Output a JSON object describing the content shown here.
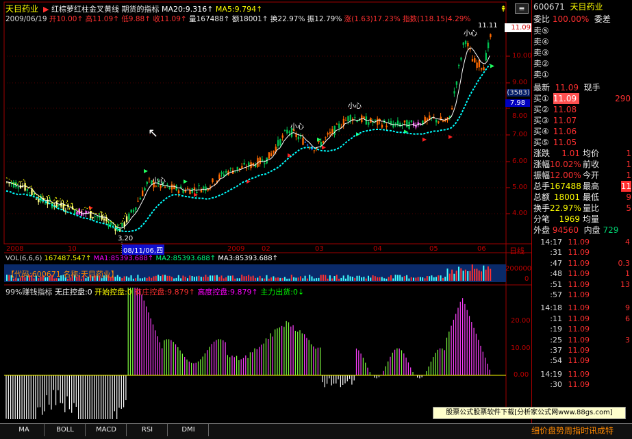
{
  "colors": {
    "up": "#ff3030",
    "up_bar": "#ff6a00",
    "down": "#00d070",
    "axis": "#c00000",
    "yellow": "#ffff00",
    "white": "#ffffff",
    "cyan": "#00ffff",
    "magenta": "#ff00ff",
    "blue_panel": "#0a2a6a"
  },
  "header": {
    "stock_name": "天目药业",
    "indicator_name": "红棕萝红柱金叉黄线 期货的指标",
    "ma20": "MA20:9.316",
    "ma5": "MA5:9.794",
    "date": "2009/06/19",
    "open": "开10.00",
    "high": "高11.09",
    "low": "低9.88",
    "close": "收11.09",
    "volume": "量167488",
    "amount": "额18001",
    "turnover": "换22.97%",
    "amplitude": "振12.79%",
    "change": "涨(1.63)17.23%",
    "index": "指数(118.15)4.29%"
  },
  "price_axis": {
    "labels": [
      "11.09",
      "10.00",
      "9.00",
      "8.00",
      "7.00",
      "6.00",
      "5.00",
      "4.00"
    ],
    "badge_3583": "(3583)",
    "badge_798": "7.98"
  },
  "price_annotations": {
    "low_mark": "3.20",
    "high_mark": "11.11",
    "xin1": "小心",
    "xin2": "小心",
    "xin3": "小心",
    "xin4": "小心"
  },
  "date_axis": {
    "labels": [
      "2008",
      "10",
      "2009",
      "02",
      "03",
      "04",
      "05",
      "06"
    ],
    "cursor_date": "08/11/06,四",
    "right_label": "日线"
  },
  "volume_panel": {
    "title": "VOL(6,6,6)",
    "vol": "167487.547",
    "ma1": "MA1:85393.688",
    "ma2": "MA2:85393.688",
    "ma3": "MA3:85393.688",
    "code_label": "【代码:600671 名称:天目药业】",
    "axis_top": "200000",
    "axis_bottom": "0"
  },
  "indicator_panel": {
    "title": "99%赚钱指标",
    "item1": "无庄控盘:0",
    "item2": "开始控盘:0",
    "item3": "有庄控盘:9.879",
    "item4": "高度控盘:9.879",
    "item5": "主力出货:0",
    "axis": [
      "20.00",
      "10.00",
      "0.00"
    ]
  },
  "quote": {
    "code": "600671",
    "name": "天目药业",
    "weibi_label": "委比",
    "weibi_value": "100.00%",
    "weicha_label": "委差",
    "sell": [
      "卖⑤",
      "卖④",
      "卖③",
      "卖②",
      "卖①"
    ],
    "latest_label": "最新",
    "latest_value": "11.09",
    "xianshou_label": "现手",
    "buy": [
      {
        "label": "买①",
        "price": "11.09",
        "vol": "290"
      },
      {
        "label": "买②",
        "price": "11.08",
        "vol": ""
      },
      {
        "label": "买③",
        "price": "11.07",
        "vol": ""
      },
      {
        "label": "买④",
        "price": "11.06",
        "vol": ""
      },
      {
        "label": "买⑤",
        "price": "11.05",
        "vol": ""
      }
    ],
    "stats": [
      {
        "l1": "涨跌",
        "v1": "1.01",
        "l2": "均价",
        "v2": "1"
      },
      {
        "l1": "涨幅",
        "v1": "10.02%",
        "l2": "前收",
        "v2": "1"
      },
      {
        "l1": "振幅",
        "v1": "12.00%",
        "l2": "今开",
        "v2": "1"
      },
      {
        "l1": "总手",
        "v1": "167488",
        "l2": "最高",
        "v2": "11"
      },
      {
        "l1": "总额",
        "v1": "18001",
        "l2": "最低",
        "v2": "9"
      },
      {
        "l1": "换手",
        "v1": "22.97%",
        "l2": "量比",
        "v2": "5"
      },
      {
        "l1": "分笔",
        "v1": "1969",
        "l2": "均量",
        "v2": ""
      }
    ],
    "waipan_label": "外盘",
    "waipan_value": "94560",
    "neipan_label": "内盘",
    "neipan_value": "729",
    "ticks": [
      {
        "t": "14:17",
        "p": "11.09",
        "v": "4"
      },
      {
        "t": ":31",
        "p": "11.09",
        "v": ""
      },
      {
        "t": ":47",
        "p": "11.09",
        "v": "0.3"
      },
      {
        "t": ":48",
        "p": "11.09",
        "v": "1"
      },
      {
        "t": ":51",
        "p": "11.09",
        "v": "13"
      },
      {
        "t": ":57",
        "p": "11.09",
        "v": ""
      },
      {
        "t": "14:18",
        "p": "11.09",
        "v": "9"
      },
      {
        "t": ":11",
        "p": "11.09",
        "v": "6"
      },
      {
        "t": ":19",
        "p": "11.09",
        "v": ""
      },
      {
        "t": ":25",
        "p": "11.09",
        "v": "3"
      },
      {
        "t": ":37",
        "p": "11.09",
        "v": ""
      },
      {
        "t": ":54",
        "p": "11.09",
        "v": ""
      },
      {
        "t": "14:19",
        "p": "11.09",
        "v": ""
      },
      {
        "t": ":30",
        "p": "11.09",
        "v": ""
      }
    ]
  },
  "watermark": "股票公式股票软件下载[分析家公式网www.88gs.com]",
  "bottom_tabs": [
    "MA",
    "BOLL",
    "MACD",
    "RSI",
    "DMI"
  ],
  "bottom_right_text": "细价盘势周指时讯成特"
}
